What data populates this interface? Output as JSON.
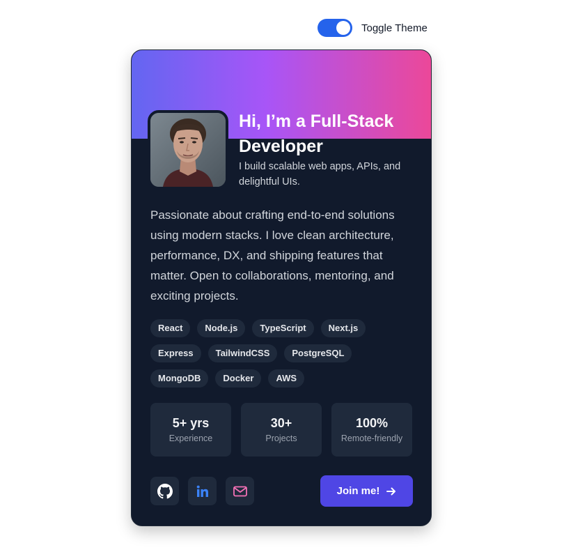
{
  "theme_toggle": {
    "label": "Toggle Theme",
    "state": "on",
    "accent": "#2563eb"
  },
  "profile": {
    "headline": "Hi, I’m a Full-Stack Developer",
    "tagline": "I build scalable web apps, APIs, and delightful UIs.",
    "bio": "Passionate about crafting end-to-end solutions using modern stacks. I love clean architecture, performance, DX, and shipping features that matter. Open to collaborations, mentoring, and exciting projects.",
    "avatar": "developer-portrait"
  },
  "skills": [
    "React",
    "Node.js",
    "TypeScript",
    "Next.js",
    "Express",
    "TailwindCSS",
    "PostgreSQL",
    "MongoDB",
    "Docker",
    "AWS"
  ],
  "stats": [
    {
      "value": "5+ yrs",
      "label": "Experience"
    },
    {
      "value": "30+",
      "label": "Projects"
    },
    {
      "value": "100%",
      "label": "Remote-friendly"
    }
  ],
  "social_links": [
    {
      "icon": "github-icon",
      "color": "#ffffff"
    },
    {
      "icon": "linkedin-icon",
      "color": "#3b82f6"
    },
    {
      "icon": "mail-icon",
      "color": "#f472b6"
    }
  ],
  "cta": {
    "label": "Join me!",
    "icon": "arrow-right-icon",
    "color": "#4f46e5"
  },
  "colors": {
    "card_bg": "#111a2c",
    "chip_bg": "#1f2a3c",
    "gradient": [
      "#6366f1",
      "#a855f7",
      "#ec4899"
    ]
  }
}
